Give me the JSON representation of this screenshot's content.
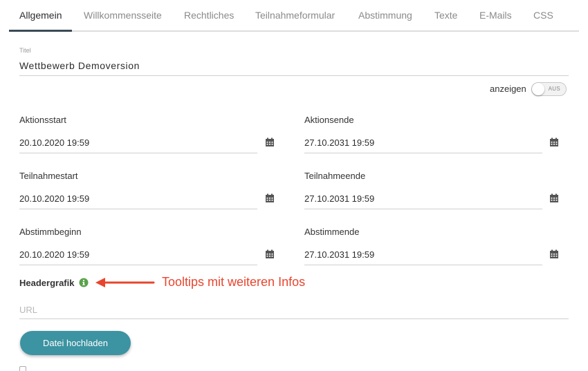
{
  "tabs": [
    {
      "label": "Allgemein",
      "active": true
    },
    {
      "label": "Willkommensseite"
    },
    {
      "label": "Rechtliches"
    },
    {
      "label": "Teilnahmeformular"
    },
    {
      "label": "Abstimmung"
    },
    {
      "label": "Texte"
    },
    {
      "label": "E-Mails"
    },
    {
      "label": "CSS"
    }
  ],
  "form": {
    "title_label": "Titel",
    "title_value": "Wettbewerb Demoversion",
    "show_label": "anzeigen",
    "show_toggle": "AUS",
    "dates": [
      {
        "label": "Aktionsstart",
        "value": "20.10.2020 19:59"
      },
      {
        "label": "Aktionsende",
        "value": "27.10.2031 19:59"
      },
      {
        "label": "Teilnahmestart",
        "value": "20.10.2020 19:59"
      },
      {
        "label": "Teilnahmeende",
        "value": "27.10.2031 19:59"
      },
      {
        "label": "Abstimmbeginn",
        "value": "20.10.2020 19:59"
      },
      {
        "label": "Abstimmende",
        "value": "27.10.2031 19:59"
      }
    ],
    "header_label": "Headergrafik",
    "url_placeholder": "URL",
    "upload_label": "Datei hochladen"
  },
  "annotation": {
    "text": "Tooltips mit weiteren Infos"
  },
  "icons": {
    "calendar": "calendar-icon",
    "info": "info-icon"
  },
  "colors": {
    "accent_button": "#3c93a1",
    "info_icon": "#5aa34b",
    "annotation": "#e8452e",
    "active_tab_underline": "#3a4a57"
  }
}
